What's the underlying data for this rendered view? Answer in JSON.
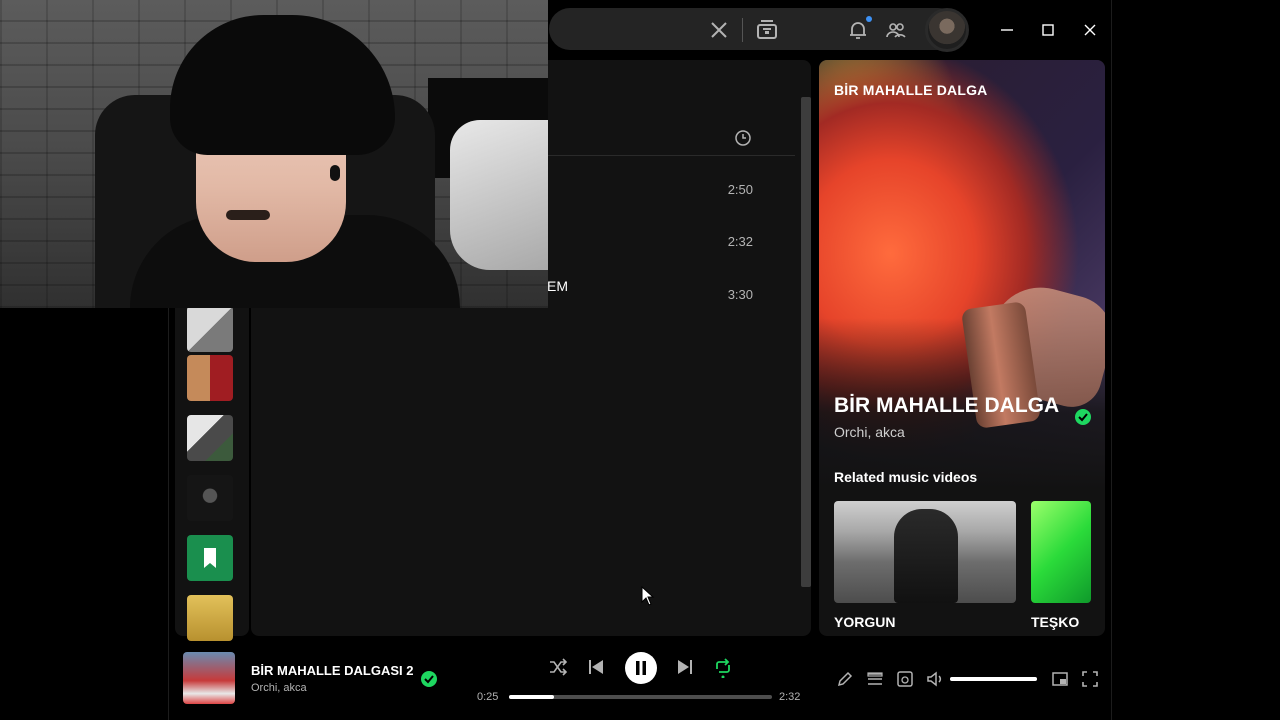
{
  "tracklist": {
    "durations": [
      "2:50",
      "2:32",
      "3:30"
    ],
    "title_fragment": "EM"
  },
  "now_playing_panel": {
    "header": "BİR MAHALLE DALGA",
    "title": "BİR MAHALLE DALGA",
    "artists": "Orchi, akca",
    "related_heading": "Related music videos",
    "videos": [
      {
        "title": "YORGUN"
      },
      {
        "title": "TEŞKO"
      }
    ]
  },
  "player": {
    "title": "BİR MAHALLE DALGASI 2",
    "artists": "Orchi, akca",
    "elapsed": "0:25",
    "total": "2:32",
    "progress": 0.17,
    "volume": 1.0,
    "repeat_active": true,
    "accent": "#1ed760"
  },
  "icons": {
    "search_clear": "close-icon",
    "browse": "browse-icon",
    "notifications": "bell-icon",
    "friends": "friends-icon",
    "shuffle": "shuffle-icon",
    "previous": "skip-back-icon",
    "pause": "pause-icon",
    "next": "skip-forward-icon",
    "repeat": "repeat-icon",
    "now_playing_view": "pen-icon",
    "queue": "queue-icon",
    "connect": "devices-icon",
    "volume": "speaker-icon",
    "miniplayer": "miniplayer-icon",
    "fullscreen": "fullscreen-icon"
  }
}
